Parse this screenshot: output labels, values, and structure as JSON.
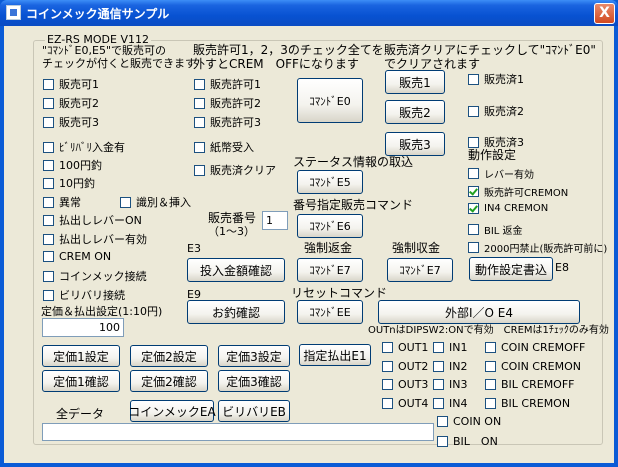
{
  "window": {
    "title": "コインメック通信サンプル",
    "close": "X"
  },
  "group": {
    "title": "EZ-RS MODE V112"
  },
  "col1": {
    "note1": "\"ｺﾏﾝﾄﾞE0,E5\"で販売可の",
    "note2": "チェックが付くと販売できます",
    "checks": [
      "販売可1",
      "販売可2",
      "販売可3",
      "ﾋﾞﾘﾊﾞﾘ入金有",
      "100円釣",
      "10円釣",
      "異常",
      "払出しレバーON",
      "払出しレバー有効",
      "CREM ON",
      "コインメック接続",
      "ビリバリ接続"
    ],
    "ident_check": "識別＆挿入",
    "price_label": "定価＆払出設定(1:10円)",
    "price_value": "100"
  },
  "col2": {
    "note1": "販売許可1，2，3のチェック全てを",
    "note2": "外すとCREM　OFFになります",
    "checks": [
      "販売許可1",
      "販売許可2",
      "販売許可3",
      "紙幣受入",
      "販売済クリア"
    ],
    "e0": "ｺﾏﾝﾄﾞE0",
    "status_label": "ステータス情報の取込",
    "e5": "ｺﾏﾝﾄﾞE5",
    "num_label1": "販売番号",
    "num_label2": "（1～3）",
    "num_value": "1",
    "designated_label": "番号指定販売コマンド",
    "e6": "ｺﾏﾝﾄﾞE6",
    "e3_tag": "E3",
    "deposit_btn": "投入金額確認",
    "refund_label": "強制返金",
    "e7a": "ｺﾏﾝﾄﾞE7",
    "e9_tag": "E9",
    "change_btn": "お釣確認",
    "reset_label": "リセットコマンド",
    "ee": "ｺﾏﾝﾄﾞEE"
  },
  "col3": {
    "note1": "販売済クリアにチェックして\"ｺﾏﾝﾄﾞE0\"",
    "note2": "でクリアされます",
    "sell": [
      "販売1",
      "販売2",
      "販売3"
    ],
    "sold": [
      "販売済1",
      "販売済2",
      "販売済3"
    ],
    "settings_label": "動作設定",
    "settings": [
      {
        "label": "レバー有効",
        "checked": false
      },
      {
        "label": "販売許可CREMON",
        "checked": true
      },
      {
        "label": "IN4 CREMON",
        "checked": true
      },
      {
        "label": "BIL 返金",
        "checked": false
      },
      {
        "label": "2000円禁止(販売許可前に)",
        "checked": false
      }
    ],
    "collect_label": "強制収金",
    "e7b": "ｺﾏﾝﾄﾞE7",
    "write_btn": "動作設定書込",
    "e8_tag": "E8",
    "ext_btn": "外部I／O E4",
    "io_note": "OUTnはDIPSW2:ONで有効　CREMは1ﾁｪｯｸのみ有効",
    "outs": [
      "OUT1",
      "OUT2",
      "OUT3",
      "OUT4"
    ],
    "ins": [
      "IN1",
      "IN2",
      "IN3",
      "IN4"
    ],
    "io_right": [
      "COIN CREMOFF",
      "COIN CREMON",
      "BIL CREMOFF",
      "BIL CREMON"
    ],
    "coin_on": "COIN ON",
    "bil_on": "BIL　ON"
  },
  "bottom": {
    "price_set": [
      "定価1設定",
      "定価2設定",
      "定価3設定"
    ],
    "price_check": [
      "定価1確認",
      "定価2確認",
      "定価3確認"
    ],
    "payout_btn": "指定払出E1",
    "all_data_label": "全データ",
    "coinmech_btn": "コインメックEA",
    "billval_btn": "ビリバリEB",
    "all_data_value": ""
  }
}
